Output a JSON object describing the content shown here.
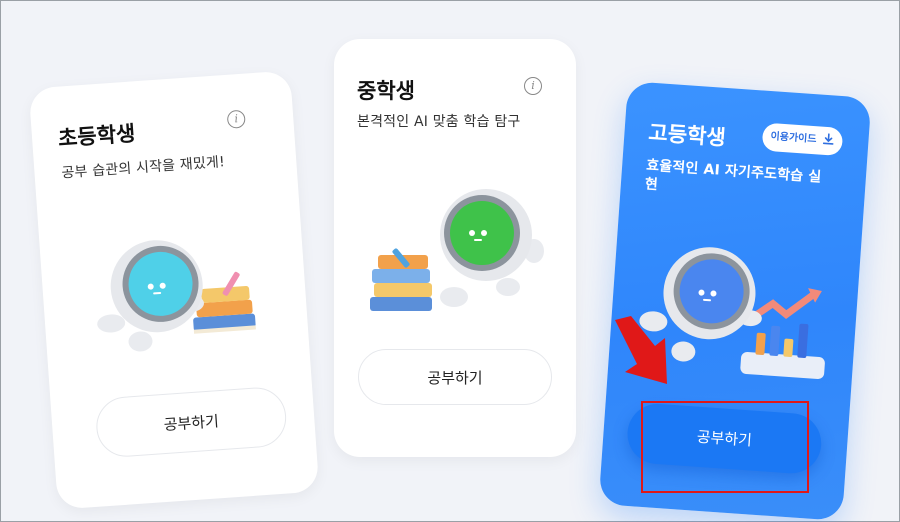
{
  "cards": [
    {
      "title": "초등학생",
      "subtitle": "공부 습관의 시작을 재밌게!",
      "button": "공부하기"
    },
    {
      "title": "중학생",
      "subtitle": "본격적인 AI 맞춤 학습 탐구",
      "button": "공부하기"
    },
    {
      "title": "고등학생",
      "subtitle_line1": "효율적인 AI 자기주도학습 실",
      "subtitle_line2": "현",
      "guide_button": "이용가이드",
      "button": "공부하기"
    }
  ],
  "info_glyph": "i",
  "colors": {
    "background": "#f1f3f8",
    "card_white": "#ffffff",
    "card_blue": "#2f86fb",
    "primary_button": "#1b78f4",
    "annotation_red": "#e01818",
    "robot_face_elementary": "#4fd0e8",
    "robot_face_middle": "#3fc24a",
    "robot_face_high": "#4a86ef"
  },
  "icons": [
    "info-icon",
    "download-icon",
    "robot-mascot",
    "books-illustration",
    "chart-illustration",
    "red-arrow-annotation"
  ]
}
